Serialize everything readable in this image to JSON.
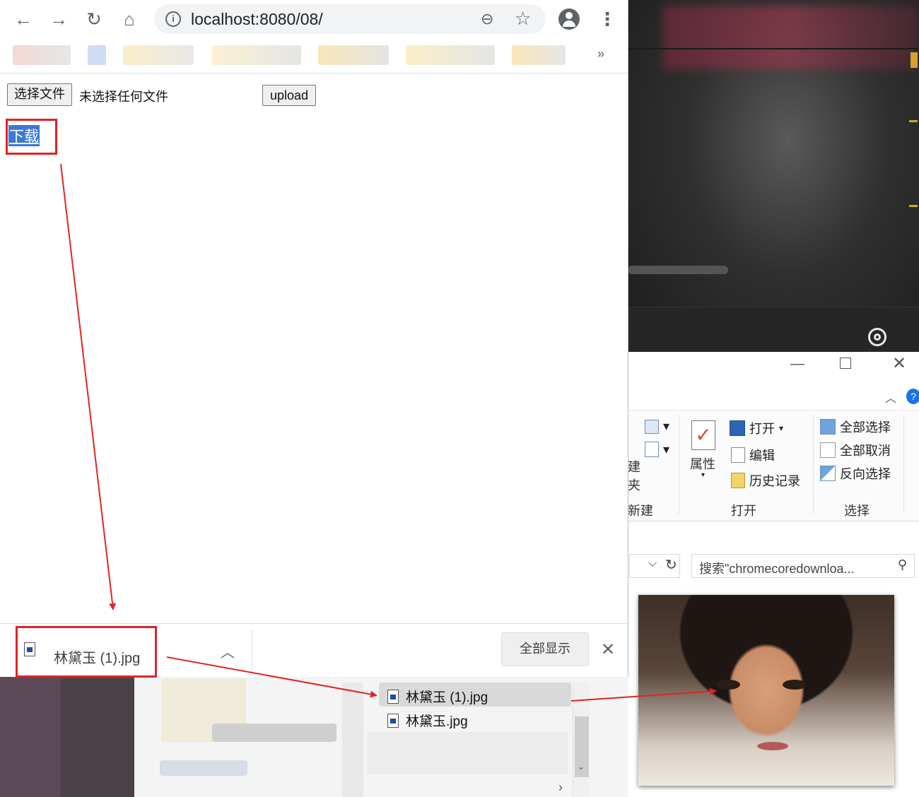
{
  "browser": {
    "url": "localhost:8080/08/",
    "page": {
      "choose_file_label": "选择文件",
      "no_file_text": "未选择任何文件",
      "upload_label": "upload",
      "download_link_text": "下载"
    },
    "download_bar": {
      "file_name": "林黛玉 (1).jpg",
      "show_all_label": "全部显示"
    }
  },
  "explorer": {
    "ribbon": {
      "properties_label": "属性",
      "open_label": "打开",
      "edit_label": "编辑",
      "history_label": "历史记录",
      "select_all_label": "全部选择",
      "select_none_label": "全部取消",
      "invert_selection_label": "反向选择",
      "group_new_label": "新建",
      "group_open_label": "打开",
      "group_select_label": "选择",
      "partial_text_1": "建",
      "partial_text_2": "夹"
    },
    "search_placeholder": "搜索\"chromecoredownloa...",
    "files": [
      {
        "name": "林黛玉 (1).jpg"
      },
      {
        "name": "林黛玉.jpg"
      }
    ]
  },
  "colors": {
    "annotation_red": "#e02424",
    "link_highlight": "#3c78d8"
  }
}
